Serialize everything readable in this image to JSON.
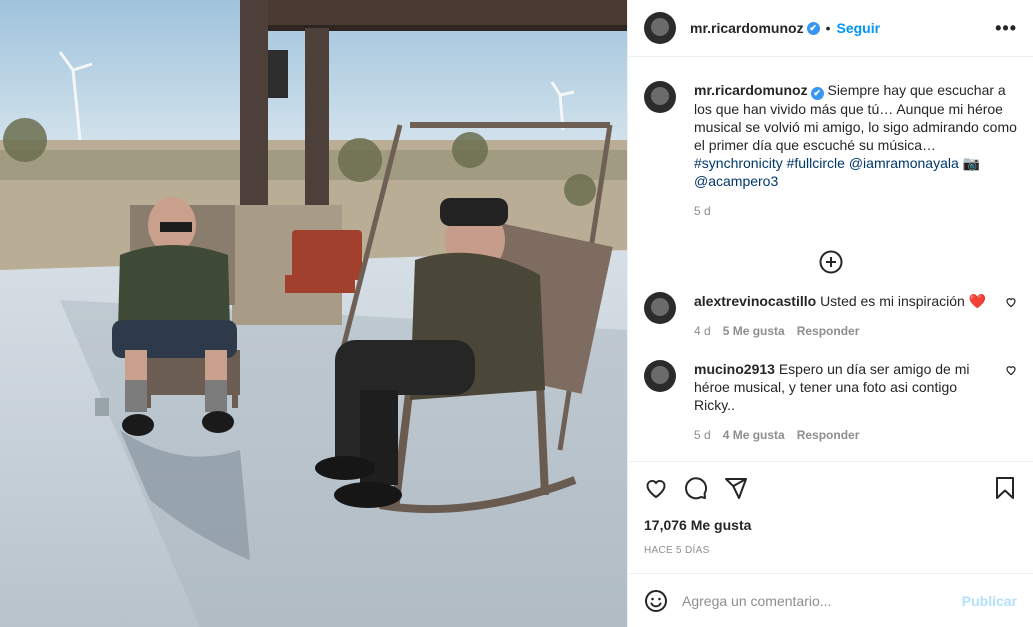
{
  "post": {
    "username": "mr.ricardomunoz",
    "verified_mark": "✔",
    "dot": "•",
    "follow_label": "Seguir",
    "more_label": "•••",
    "caption_text": "Siempre hay que escuchar a los que han vivido más que tú… Aunque mi héroe musical se volvió mi amigo, lo sigo admirando como el primer día que escuché su música…",
    "caption_tags": "#synchronicity #fullcircle @iamramonayala",
    "caption_camera": "📷",
    "caption_tag2": "@acampero3",
    "caption_time": "5 d"
  },
  "comments": [
    {
      "username": "alextrevinocastillo",
      "text": "Usted es mi inspiración",
      "emoji": "❤️",
      "time": "4 d",
      "likes": "5 Me gusta",
      "reply": "Responder"
    },
    {
      "username": "mucino2913",
      "text": "Espero un día ser amigo de mi héroe musical, y tener una foto asi contigo Ricky..",
      "time": "5 d",
      "likes": "4 Me gusta",
      "reply": "Responder"
    }
  ],
  "stats": {
    "likes": "17,076 Me gusta",
    "ago": "HACE 5 DÍAS"
  },
  "composer": {
    "placeholder": "Agrega un comentario...",
    "post_label": "Publicar"
  },
  "icons": {
    "like": "heart-icon",
    "comment": "comment-icon",
    "share": "share-icon",
    "save": "bookmark-icon",
    "emoji": "emoji-icon",
    "load_more": "plus-circle-icon",
    "options": "more-icon"
  },
  "colors": {
    "accent": "#0095f6",
    "link": "#00376b",
    "muted": "#8e8e8e",
    "verified": "#3897f0"
  }
}
